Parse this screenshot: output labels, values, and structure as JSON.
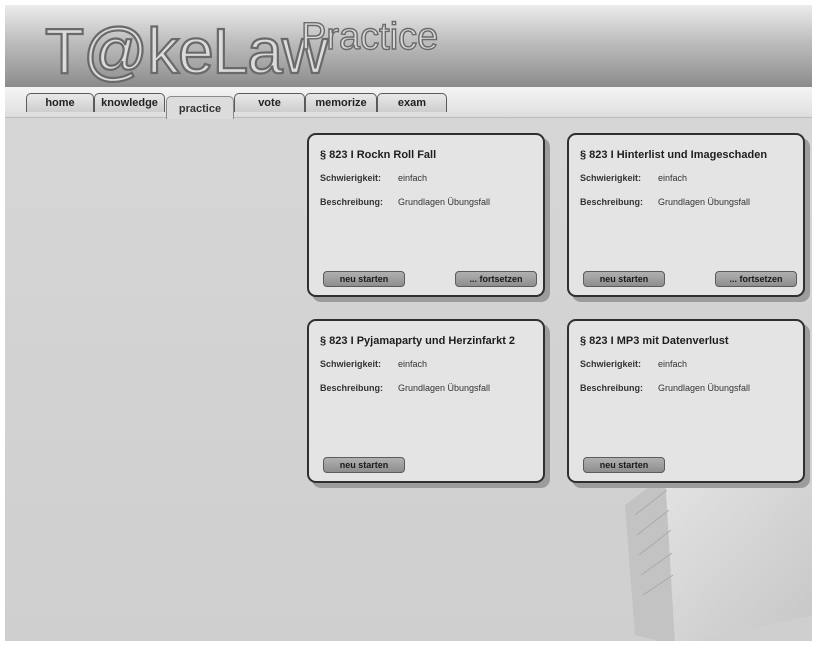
{
  "logo": {
    "brand": "T@keLaw",
    "sub": "Practice"
  },
  "nav": {
    "tabs": [
      {
        "label": "home"
      },
      {
        "label": "knowledge"
      },
      {
        "label": "practice",
        "active": true
      },
      {
        "label": "vote"
      },
      {
        "label": "memorize"
      },
      {
        "label": "exam"
      }
    ]
  },
  "cards": [
    {
      "title": "§ 823 I Rockn Roll Fall",
      "difficulty_label": "Schwierigkeit:",
      "difficulty": "einfach",
      "description_label": "Beschreibung:",
      "description": "Grundlagen Übungsfall",
      "start_label": "neu starten",
      "continue_label": "... fortsetzen"
    },
    {
      "title": "§ 823 I Hinterlist und Imageschaden",
      "difficulty_label": "Schwierigkeit:",
      "difficulty": "einfach",
      "description_label": "Beschreibung:",
      "description": "Grundlagen Übungsfall",
      "start_label": "neu starten",
      "continue_label": "... fortsetzen"
    },
    {
      "title": "§ 823 I Pyjamaparty und Herzinfarkt 2",
      "difficulty_label": "Schwierigkeit:",
      "difficulty": "einfach",
      "description_label": "Beschreibung:",
      "description": "Grundlagen Übungsfall",
      "start_label": "neu starten"
    },
    {
      "title": "§ 823 I MP3 mit Datenverlust",
      "difficulty_label": "Schwierigkeit:",
      "difficulty": "einfach",
      "description_label": "Beschreibung:",
      "description": "Grundlagen Übungsfall",
      "start_label": "neu starten"
    }
  ]
}
